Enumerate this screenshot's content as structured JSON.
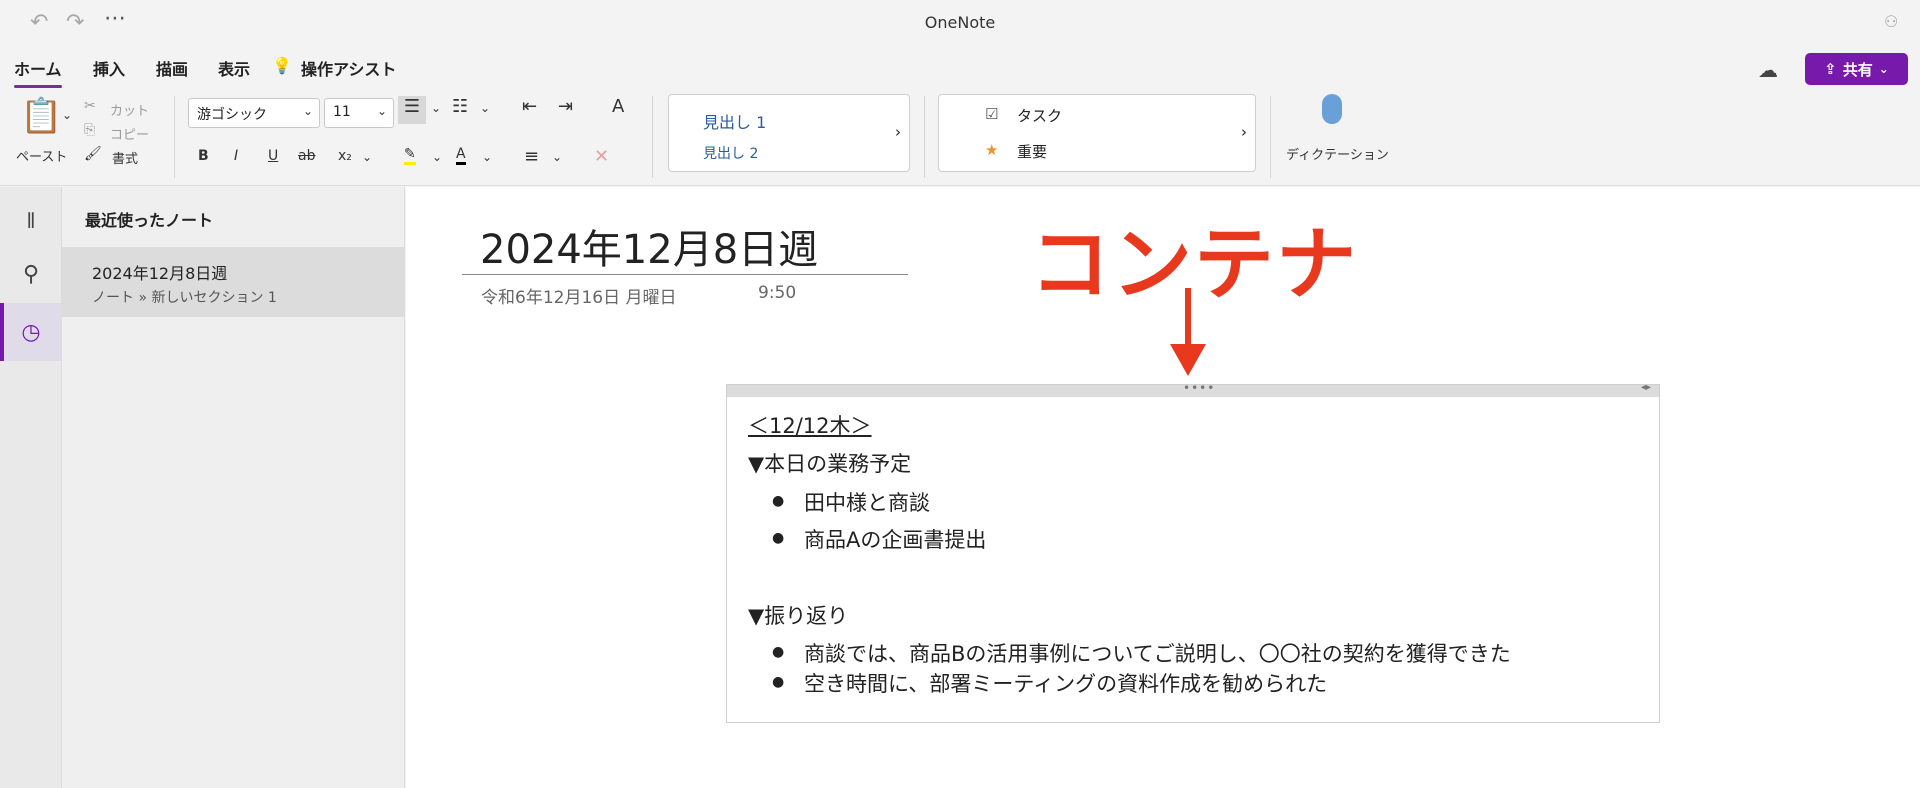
{
  "app": {
    "title": "OneNote"
  },
  "menu": {
    "tabs": [
      "ホーム",
      "挿入",
      "描画",
      "表示",
      "操作アシスト"
    ],
    "share_label": "共有"
  },
  "ribbon": {
    "paste": "ペースト",
    "cut": "カット",
    "copy": "コピー",
    "format": "書式",
    "font_name": "游ゴシック",
    "font_size": "11",
    "style1": "見出し 1",
    "style2": "見出し 2",
    "tag_task": "タスク",
    "tag_important": "重要",
    "dictation": "ディクテーション"
  },
  "sidebar": {
    "header": "最近使ったノート",
    "item": {
      "title": "2024年12月8日週",
      "subtitle": "ノート » 新しいセクション 1"
    }
  },
  "page": {
    "title": "2024年12月8日週",
    "date": "令和6年12月16日 月曜日",
    "time": "9:50"
  },
  "annotation": {
    "label": "コンテナ",
    "color": "#e8391e"
  },
  "note": {
    "date_heading": "＜12/12木＞",
    "section1": "▼本日の業務予定",
    "section1_items": [
      "田中様と商談",
      "商品Aの企画書提出"
    ],
    "section2": "▼振り返り",
    "section2_items": [
      "商談では、商品Bの活用事例についてご説明し、〇〇社の契約を獲得できた",
      "空き時間に、部署ミーティングの資料作成を勧められた"
    ]
  },
  "colors": {
    "accent": "#7719aa",
    "annotation": "#e8391e"
  }
}
